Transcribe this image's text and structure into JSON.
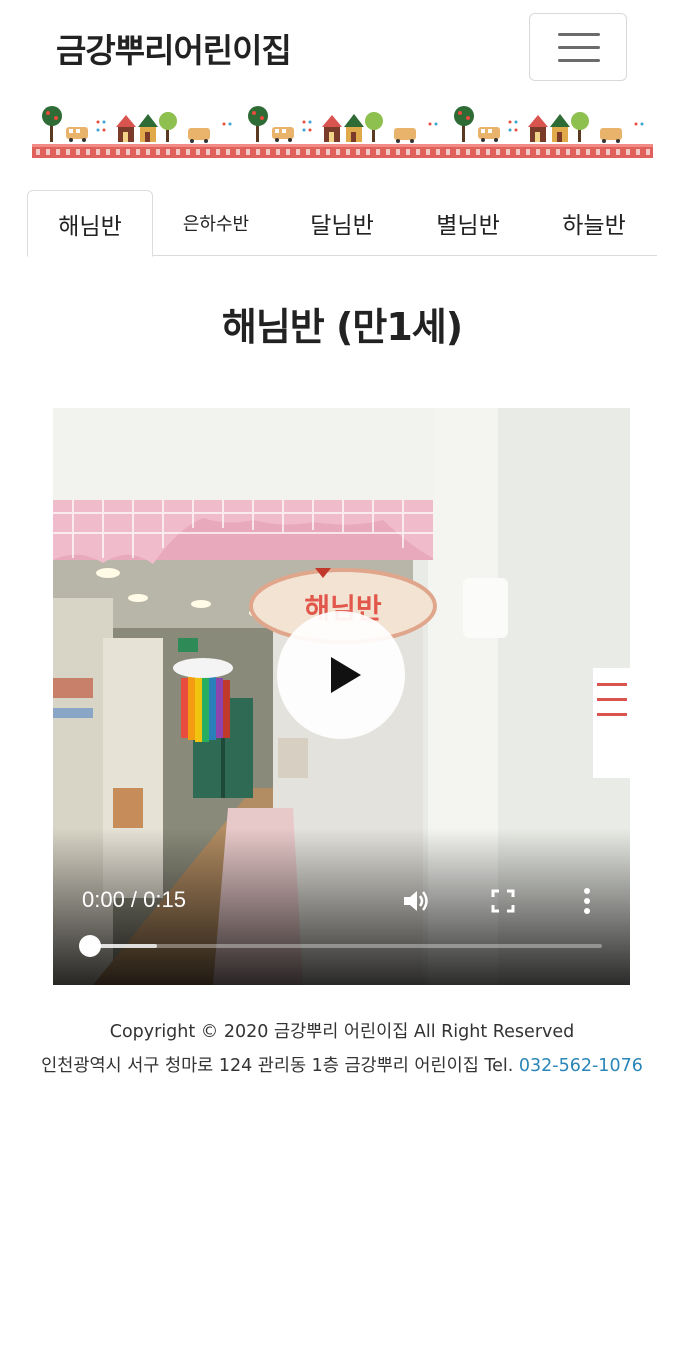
{
  "navbar": {
    "brand": "금강뿌리어린이집",
    "menu_toggle_icon": "hamburger-menu-icon"
  },
  "tabs": [
    {
      "label": "해님반",
      "active": true
    },
    {
      "label": "은하수반",
      "active": false
    },
    {
      "label": "달님반",
      "active": false
    },
    {
      "label": "별님반",
      "active": false
    },
    {
      "label": "하늘반",
      "active": false
    }
  ],
  "page_title": "해님반 (만1세)",
  "video": {
    "sign_text": "해님반",
    "time_display": "0:00 / 0:15",
    "progress_played": 0.0,
    "progress_buffered": 0.13,
    "icons": {
      "play": "play-icon",
      "volume": "volume-icon",
      "fullscreen": "fullscreen-icon",
      "more": "more-vertical-icon"
    }
  },
  "footer": {
    "copyright": "Copyright © 2020 금강뿌리 어린이집 All Right Reserved",
    "address": "인천광역시 서구 청마로 124 관리동 1층 금강뿌리 어린이집 Tel.",
    "tel": "032-562-1076"
  },
  "colors": {
    "link": "#2a86b8",
    "fence": "#d9534f"
  }
}
